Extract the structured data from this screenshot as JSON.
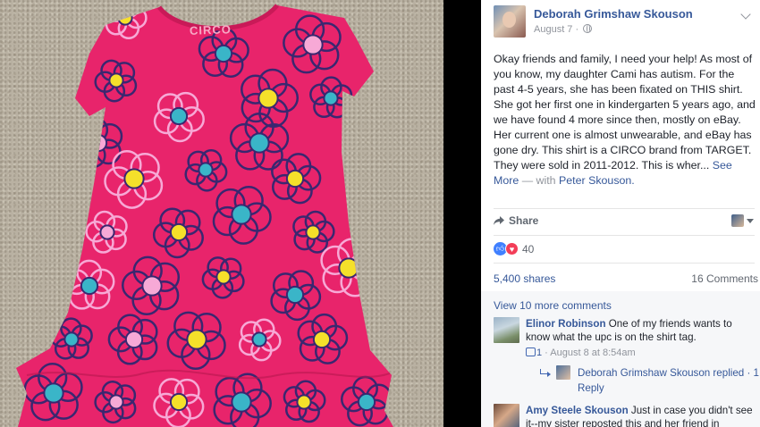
{
  "photo": {
    "shirt_brand": "CIRCO",
    "colors": {
      "shirt": "#e8246b",
      "flower_outline": "#3a2770",
      "yellow": "#f5e02a",
      "teal": "#3ab5c8",
      "light_pink": "#f7a9d6"
    }
  },
  "post": {
    "author": "Deborah Grimshaw Skouson",
    "date": "August 7",
    "body": "Okay friends and family, I need your help! As most of you know, my daughter Cami has autism. For the past 4-5 years, she has been fixated on THIS shirt. She got her first one in kindergarten 5 years ago, and we have found 4 more since then, mostly on eBay. Her current one is almost unwearable, and eBay has gone dry. This shirt is a CIRCO brand from TARGET. They were sold in 2011-2012. This is wher...",
    "see_more": "See More",
    "with_text": "— with",
    "tagged": "Peter Skouson."
  },
  "actions": {
    "share": "Share"
  },
  "reactions": {
    "count": "40"
  },
  "counts": {
    "shares": "5,400 shares",
    "comments": "16 Comments"
  },
  "comments": {
    "view_more": "View 10 more comments",
    "items": [
      {
        "name": "Elinor Robinson",
        "text": "One of my friends wants to know what the upc is on the shirt tag.",
        "likes": "1",
        "time": "August 8 at 8:54am",
        "reply_text": "Deborah Grimshaw Skouson replied · 1",
        "reply_label": "Reply"
      },
      {
        "name": "Amy Steele Skouson",
        "text": "Just in case you didn't see it--my sister reposted this and her friend in Germany"
      }
    ]
  },
  "theme": {
    "link": "#365899",
    "muted": "#90949c",
    "text": "#1d2129",
    "comments_bg": "#f6f7f9"
  }
}
